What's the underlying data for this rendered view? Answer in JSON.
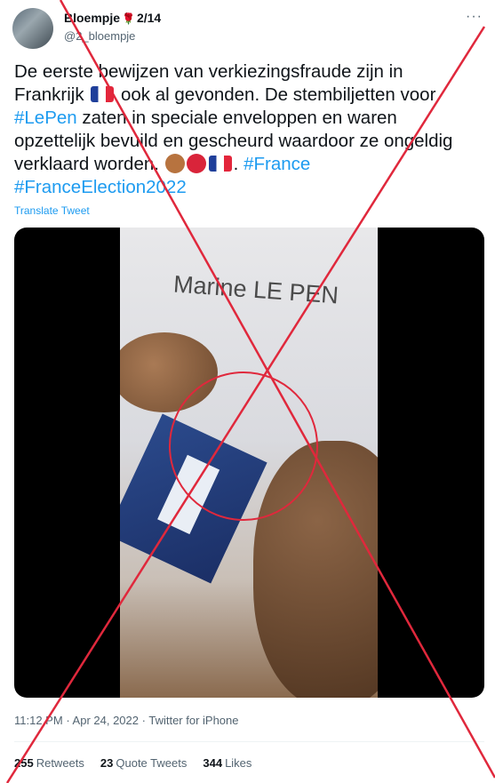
{
  "author": {
    "display_name": "Bloempje",
    "name_suffix": "2/14",
    "handle": "@2_bloempje",
    "more_label": "···"
  },
  "tweet": {
    "text_line1": "De eerste bewijzen van verkiezingsfraude zijn in",
    "text_line2a": "Frankrijk",
    "text_line2b": "ook al gevonden. De stembiljetten voor",
    "hashtag_lepen": "#LePen",
    "text_line3": "zaten in speciale enveloppen en waren",
    "text_line4": "opzettelijk bevuild en gescheurd waardoor ze ongeldig",
    "text_line5": "verklaard worden.",
    "hashtag_france": "#France",
    "hashtag_election": "#FranceElection2022",
    "translate_label": "Translate Tweet"
  },
  "media": {
    "video_caption_text": "Marine LE PEN"
  },
  "meta": {
    "time": "11:12 PM",
    "date": "Apr 24, 2022",
    "source": "Twitter for iPhone"
  },
  "stats": {
    "retweets_count": "255",
    "retweets_label": "Retweets",
    "quotes_count": "23",
    "quotes_label": "Quote Tweets",
    "likes_count": "344",
    "likes_label": "Likes"
  },
  "colors": {
    "link": "#1d9bf0",
    "overlay_cross": "#e0283c",
    "secondary_text": "#536471"
  },
  "icons": [
    "rose-icon",
    "france-flag-icon",
    "see-no-evil-monkey-icon",
    "angry-face-icon",
    "more-icon"
  ]
}
